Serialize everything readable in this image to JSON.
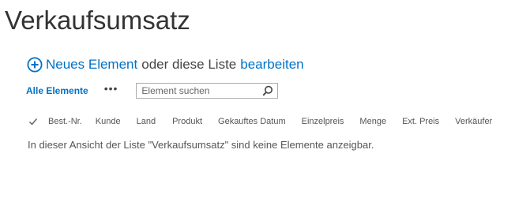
{
  "page": {
    "title": "Verkaufsumsatz"
  },
  "actions": {
    "new_item": "Neues Element",
    "or_text": "oder diese Liste",
    "edit": "bearbeiten"
  },
  "view": {
    "name": "Alle Elemente",
    "more": "•••"
  },
  "search": {
    "placeholder": "Element suchen"
  },
  "columns": [
    "Best.-Nr.",
    "Kunde",
    "Land",
    "Produkt",
    "Gekauftes Datum",
    "Einzelpreis",
    "Menge",
    "Ext. Preis",
    "Verkäufer"
  ],
  "empty_message": "In dieser Ansicht der Liste \"Verkaufsumsatz\" sind keine Elemente anzeigbar.",
  "colors": {
    "link": "#0072c6",
    "text": "#444444"
  }
}
